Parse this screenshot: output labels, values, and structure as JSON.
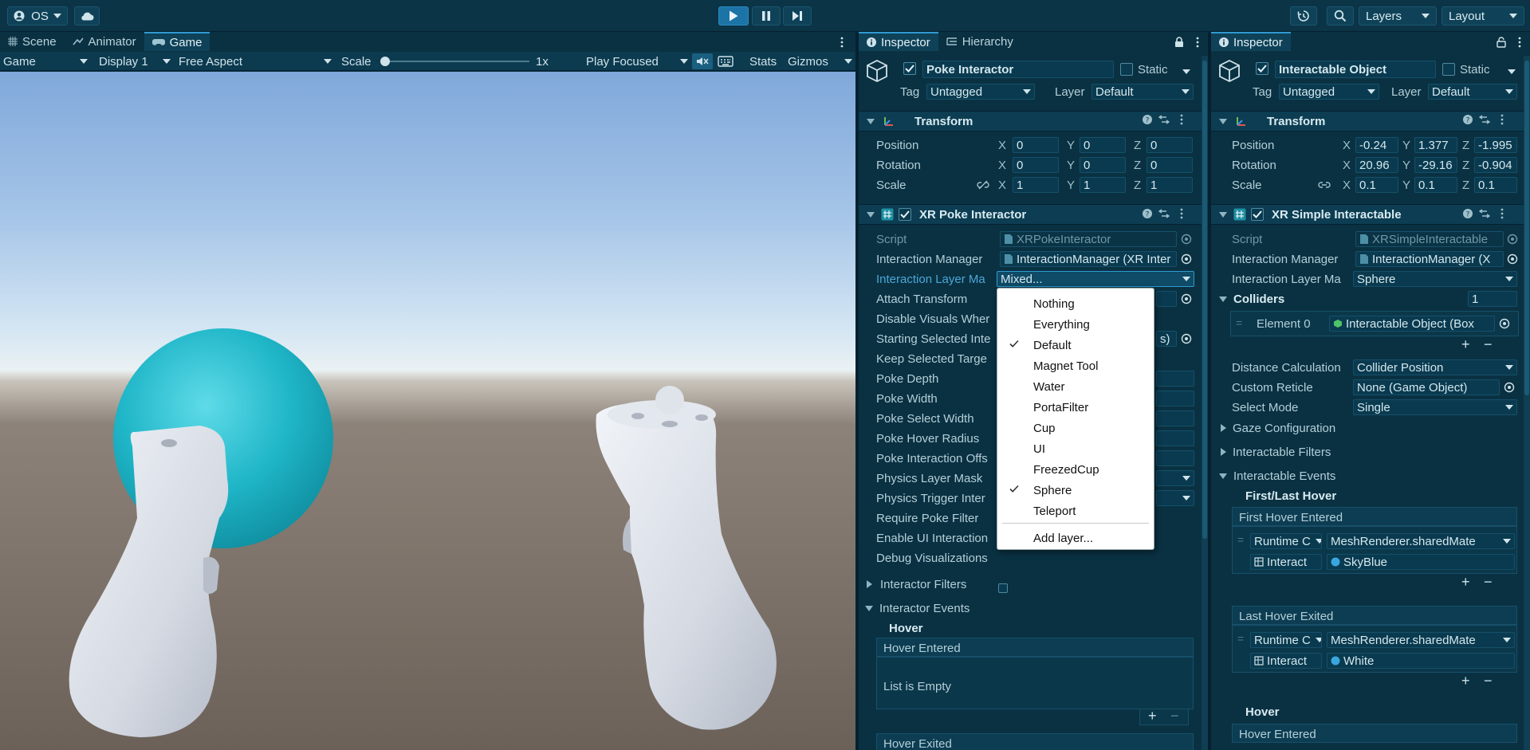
{
  "toolbar": {
    "account_label": "OS",
    "layers_label": "Layers",
    "layout_label": "Layout"
  },
  "game_view": {
    "tabs": [
      "Scene",
      "Animator",
      "Game"
    ],
    "mode_select": "Game",
    "display_select": "Display 1",
    "aspect_select": "Free Aspect",
    "scale_label": "Scale",
    "scale_value": "1x",
    "play_mode_select": "Play Focused",
    "stats_label": "Stats",
    "gizmos_label": "Gizmos"
  },
  "inspector_left": {
    "tabs": [
      "Inspector",
      "Hierarchy"
    ],
    "object_name": "Poke Interactor",
    "static_label": "Static",
    "tag_label": "Tag",
    "tag_value": "Untagged",
    "layer_label": "Layer",
    "layer_value": "Default",
    "transform": {
      "title": "Transform",
      "position_label": "Position",
      "rotation_label": "Rotation",
      "scale_label": "Scale",
      "position": [
        "0",
        "0",
        "0"
      ],
      "rotation": [
        "0",
        "0",
        "0"
      ],
      "scale": [
        "1",
        "1",
        "1"
      ]
    },
    "component": {
      "title": "XR Poke Interactor",
      "rows": [
        {
          "label": "Script",
          "value": "XRPokeInteractor"
        },
        {
          "label": "Interaction Manager",
          "value": "InteractionManager (XR Inter"
        },
        {
          "label": "Interaction Layer Ma",
          "value": "Mixed..."
        },
        {
          "label": "Attach Transform",
          "value": ""
        },
        {
          "label": "Disable Visuals Wher",
          "value": ""
        },
        {
          "label": "Starting Selected Inte",
          "value": "s)"
        },
        {
          "label": "Keep Selected Targe",
          "value": ""
        },
        {
          "label": "Poke Depth",
          "value": ""
        },
        {
          "label": "Poke Width",
          "value": ""
        },
        {
          "label": "Poke Select Width",
          "value": ""
        },
        {
          "label": "Poke Hover Radius",
          "value": ""
        },
        {
          "label": "Poke Interaction Offs",
          "value": ""
        },
        {
          "label": "Physics Layer Mask",
          "value": ""
        },
        {
          "label": "Physics Trigger Inter",
          "value": ""
        },
        {
          "label": "Require Poke Filter",
          "value": ""
        },
        {
          "label": "Enable UI Interaction",
          "value": ""
        },
        {
          "label": "Debug Visualizations",
          "value": ""
        }
      ]
    },
    "interactor_filters": "Interactor Filters",
    "interactor_events": "Interactor Events",
    "hover_heading": "Hover",
    "hover_entered": "Hover Entered",
    "list_empty": "List is Empty",
    "hover_exited": "Hover Exited"
  },
  "layer_menu": {
    "items": [
      {
        "label": "Nothing",
        "checked": false
      },
      {
        "label": "Everything",
        "checked": false
      },
      {
        "label": "Default",
        "checked": true
      },
      {
        "label": "Magnet Tool",
        "checked": false
      },
      {
        "label": "Water",
        "checked": false
      },
      {
        "label": "PortaFilter",
        "checked": false
      },
      {
        "label": "Cup",
        "checked": false
      },
      {
        "label": "UI",
        "checked": false
      },
      {
        "label": "FreezedCup",
        "checked": false
      },
      {
        "label": "Sphere",
        "checked": true
      },
      {
        "label": "Teleport",
        "checked": false
      }
    ],
    "add_layer": "Add layer..."
  },
  "inspector_right": {
    "tab": "Inspector",
    "object_name": "Interactable Object",
    "static_label": "Static",
    "tag_label": "Tag",
    "tag_value": "Untagged",
    "layer_label": "Layer",
    "layer_value": "Default",
    "transform": {
      "title": "Transform",
      "position_label": "Position",
      "rotation_label": "Rotation",
      "scale_label": "Scale",
      "position": [
        "-0.24",
        "1.377",
        "-1.995"
      ],
      "rotation": [
        "20.96",
        "-29.16",
        "-0.904"
      ],
      "scale": [
        "0.1",
        "0.1",
        "0.1"
      ]
    },
    "component": {
      "title": "XR Simple Interactable",
      "script_label": "Script",
      "script_value": "XRSimpleInteractable",
      "manager_label": "Interaction Manager",
      "manager_value": "InteractionManager (X",
      "layer_mask_label": "Interaction Layer Ma",
      "layer_mask_value": "Sphere",
      "colliders_label": "Colliders",
      "colliders_count": "1",
      "element_label": "Element 0",
      "element_value": "Interactable Object (Box",
      "distance_label": "Distance Calculation",
      "distance_value": "Collider Position",
      "reticle_label": "Custom Reticle",
      "reticle_value": "None (Game Object)",
      "select_mode_label": "Select Mode",
      "select_mode_value": "Single",
      "gaze_label": "Gaze Configuration",
      "filters_label": "Interactable Filters",
      "events_label": "Interactable Events",
      "first_last_hover": "First/Last Hover",
      "first_hover_entered": "First Hover Entered",
      "runtime_label": "Runtime C",
      "method_value": "MeshRenderer.sharedMate",
      "object_label": "Interact",
      "material_1": "SkyBlue",
      "last_hover_exited": "Last Hover Exited",
      "material_2": "White",
      "hover_heading": "Hover",
      "hover_entered": "Hover Entered"
    }
  },
  "colors": {
    "accent": "#1c73a6",
    "panel": "#0a3142",
    "sphere": "#1fb6c8",
    "controller": "#d9dee6"
  }
}
